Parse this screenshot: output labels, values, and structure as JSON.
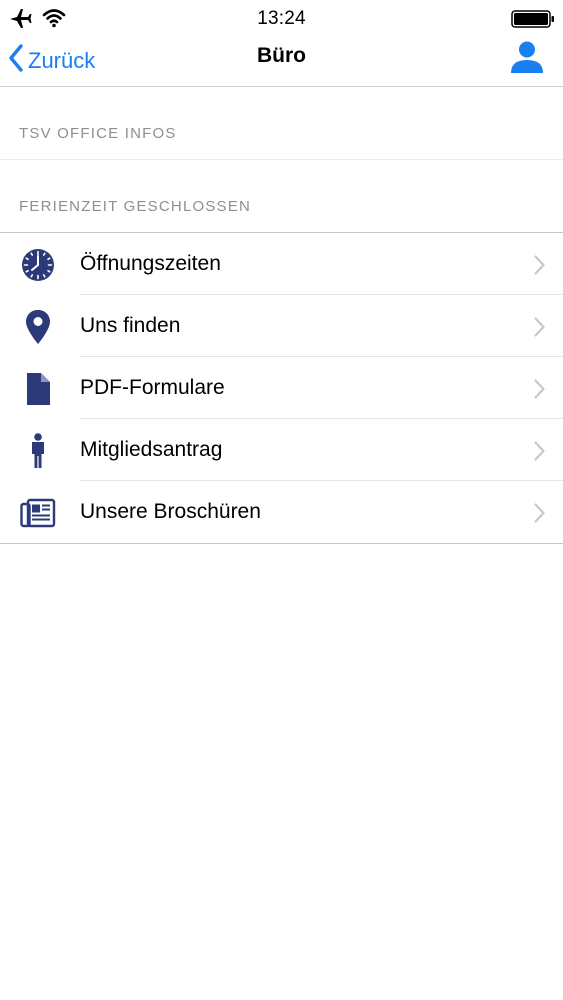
{
  "status_bar": {
    "time": "13:24",
    "icons": [
      "airplane-icon",
      "wifi-icon",
      "battery-icon"
    ]
  },
  "nav": {
    "back_label": "Zurück",
    "title": "Büro",
    "right_icon": "person-icon"
  },
  "sections": {
    "section1_header": "TSV OFFICE INFOS",
    "section2_header": "FERIENZEIT GESCHLOSSEN"
  },
  "menu": {
    "items": [
      {
        "label": "Öffnungszeiten",
        "icon": "clock-icon"
      },
      {
        "label": "Uns finden",
        "icon": "location-pin-icon"
      },
      {
        "label": "PDF-Formulare",
        "icon": "document-icon"
      },
      {
        "label": "Mitgliedsantrag",
        "icon": "person-standing-icon"
      },
      {
        "label": "Unsere Broschüren",
        "icon": "brochure-icon"
      }
    ]
  },
  "colors": {
    "accent": "#1a7ff0",
    "icon_navy": "#2d3a7a",
    "section_header_text": "#8e8e93",
    "chevron": "#c7c7cc"
  }
}
